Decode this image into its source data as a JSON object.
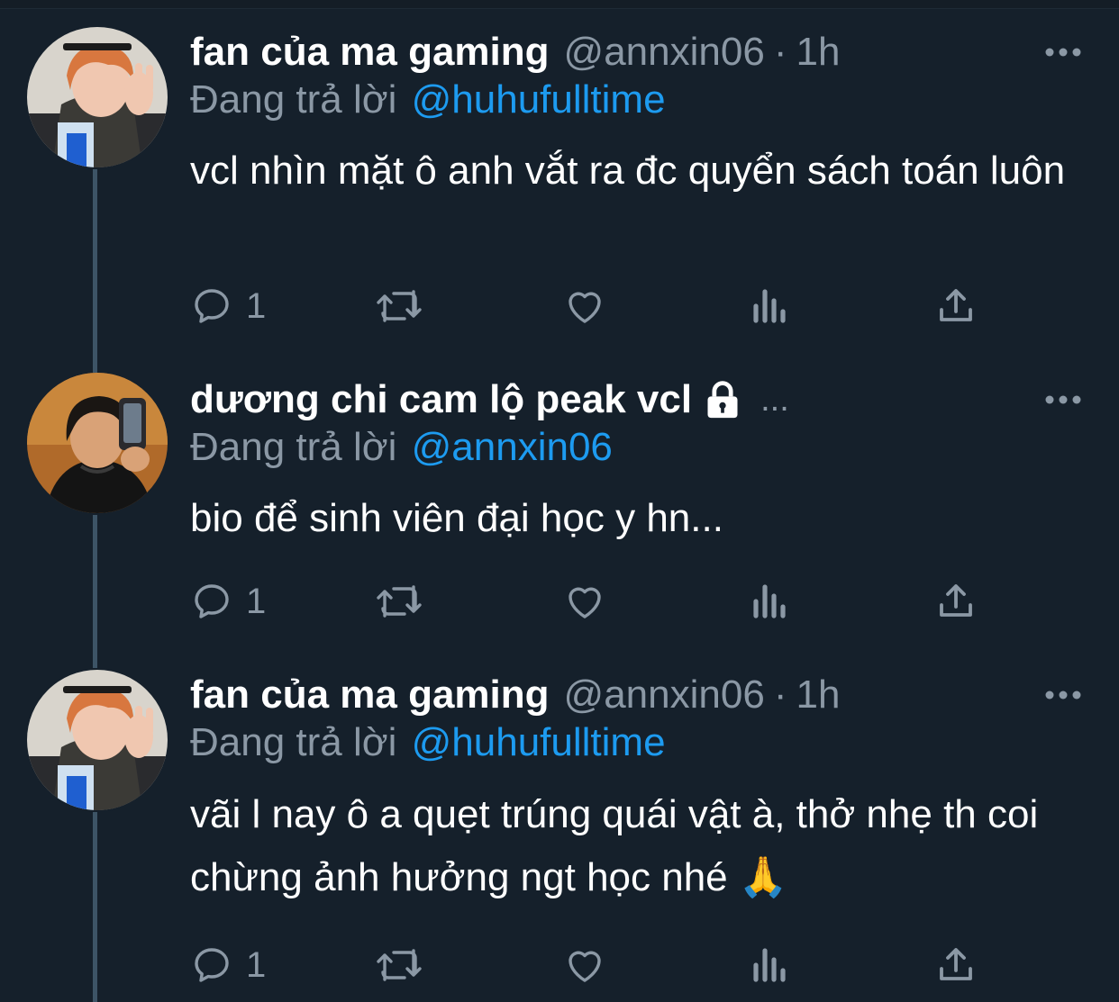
{
  "tweets": [
    {
      "display_name": "fan của ma gaming",
      "handle": "@annxin06",
      "dot": "·",
      "time": "1h",
      "reply_prefix": "Đang trả lời",
      "reply_to": "@huhufulltime",
      "text": "vcl nhìn mặt ô anh vắt ra đc quyển sách toán luôn",
      "reply_count": "1",
      "avatar": "avatar-orange-hair"
    },
    {
      "display_name": "dương chi cam lộ peak vcl",
      "ellipsis": "...",
      "protected_icon": "lock-icon",
      "reply_prefix": "Đang trả lời",
      "reply_to": "@annxin06",
      "text": "bio để sinh viên đại học y hn...",
      "reply_count": "1",
      "avatar": "avatar-dark-hair-phone"
    },
    {
      "display_name": "fan của ma gaming",
      "handle": "@annxin06",
      "dot": "·",
      "time": "1h",
      "reply_prefix": "Đang trả lời",
      "reply_to": "@huhufulltime",
      "text": "vãi l nay ô a quẹt trúng quái vật à, thở nhẹ th coi chừng ảnh hưởng ngt học nhé 🙏",
      "reply_count": "1",
      "avatar": "avatar-orange-hair"
    }
  ],
  "icons": {
    "reply": "reply-icon",
    "retweet": "retweet-icon",
    "like": "heart-icon",
    "views": "views-icon",
    "share": "share-icon",
    "more": "more-icon"
  },
  "colors": {
    "background": "#15202b",
    "text": "#ffffff",
    "secondary": "#8b98a5",
    "link": "#1d9bf0",
    "thread_line": "#3d5466"
  }
}
